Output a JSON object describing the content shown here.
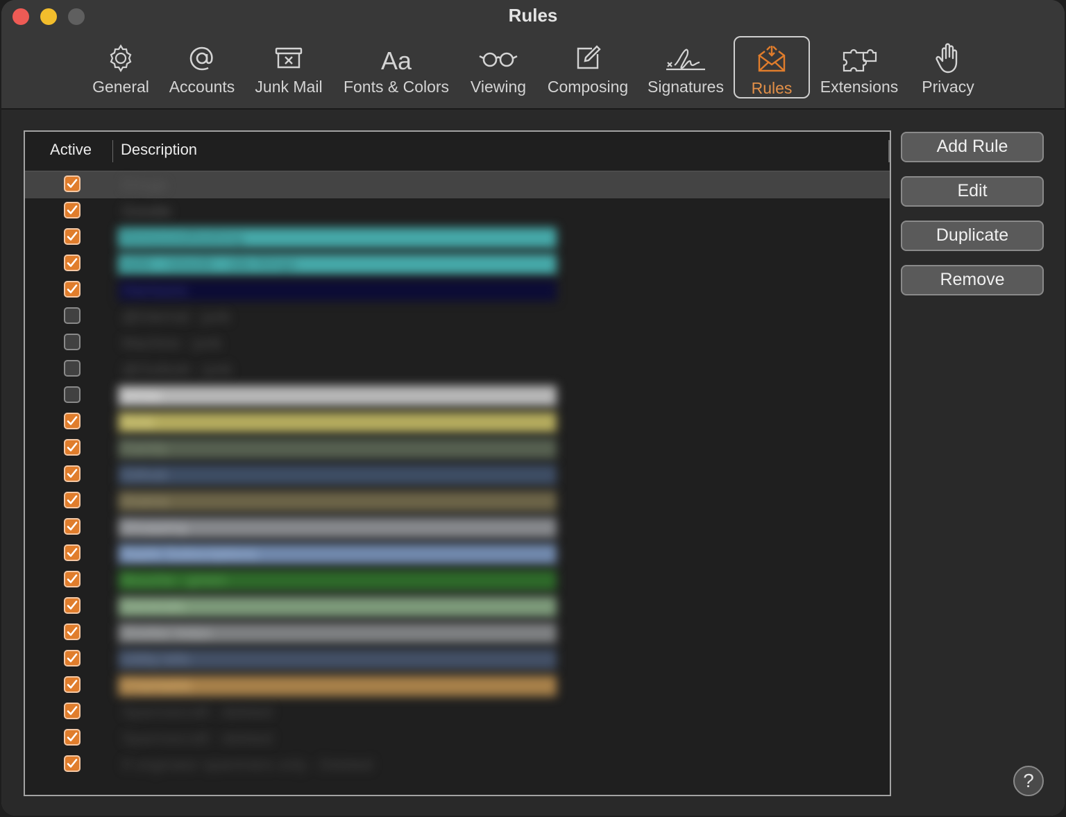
{
  "window": {
    "title": "Rules"
  },
  "toolbar": {
    "tabs": [
      {
        "id": "general",
        "label": "General",
        "icon": "gear-icon"
      },
      {
        "id": "accounts",
        "label": "Accounts",
        "icon": "at-sign-icon"
      },
      {
        "id": "junk",
        "label": "Junk Mail",
        "icon": "junk-bin-icon"
      },
      {
        "id": "fonts",
        "label": "Fonts & Colors",
        "icon": "font-icon"
      },
      {
        "id": "viewing",
        "label": "Viewing",
        "icon": "glasses-icon"
      },
      {
        "id": "composing",
        "label": "Composing",
        "icon": "compose-icon"
      },
      {
        "id": "signatures",
        "label": "Signatures",
        "icon": "signature-icon"
      },
      {
        "id": "rules",
        "label": "Rules",
        "icon": "rules-envelope-icon",
        "selected": true
      },
      {
        "id": "extensions",
        "label": "Extensions",
        "icon": "puzzle-icon"
      },
      {
        "id": "privacy",
        "label": "Privacy",
        "icon": "hand-icon"
      }
    ]
  },
  "table": {
    "headers": {
      "active": "Active",
      "description": "Description"
    },
    "rows": [
      {
        "active": true,
        "desc": "Ertuge",
        "color": "",
        "text": "#5a5a5a",
        "selected": true
      },
      {
        "active": true,
        "desc": "Goodie",
        "color": "",
        "text": "#5a5a5a"
      },
      {
        "active": true,
        "desc": "AnnoucedNothing",
        "color": "#46a9a9",
        "text": "#2a6b6b"
      },
      {
        "active": true,
        "desc": "addr - newsltr - site things",
        "color": "#46a9a9",
        "text": "#2a6b6b"
      },
      {
        "active": true,
        "desc": "Harrisons",
        "color": "#0c0c36",
        "text": "#3a3a7a"
      },
      {
        "active": false,
        "desc": "@Internal - junk",
        "color": "",
        "text": "#4e4e4e"
      },
      {
        "active": false,
        "desc": "Machine - junk",
        "color": "",
        "text": "#4e4e4e"
      },
      {
        "active": false,
        "desc": "@Outlook - junk",
        "color": "",
        "text": "#4e4e4e"
      },
      {
        "active": false,
        "desc": "White",
        "color": "#b8b8b8",
        "text": "#e8e8e8"
      },
      {
        "active": true,
        "desc": "Note",
        "color": "#b5ac5e",
        "text": "#e0d890"
      },
      {
        "active": true,
        "desc": "Family",
        "color": "#566050",
        "text": "#7a8670"
      },
      {
        "active": true,
        "desc": "Github",
        "color": "#3e4d64",
        "text": "#6d7d96"
      },
      {
        "active": true,
        "desc": "Drama",
        "color": "#6c6448",
        "text": "#958c6c"
      },
      {
        "active": true,
        "desc": "Shopping",
        "color": "#86888c",
        "text": "#b6b8bc"
      },
      {
        "active": true,
        "desc": "Apple Subscriptions",
        "color": "#7189ad",
        "text": "#a4bcde"
      },
      {
        "active": true,
        "desc": "Bouche - green",
        "color": "#2e6a2a",
        "text": "#5aa052"
      },
      {
        "active": true,
        "desc": "Generals",
        "color": "#7d9a7a",
        "text": "#a8c4a4"
      },
      {
        "active": true,
        "desc": "Shelter helps",
        "color": "#7e8082",
        "text": "#aeb0b2"
      },
      {
        "active": true,
        "desc": "Utility bills",
        "color": "#435066",
        "text": "#6d7c96"
      },
      {
        "active": true,
        "desc": "Charitable",
        "color": "#a8814a",
        "text": "#d6ae70"
      },
      {
        "active": true,
        "desc": "Sparrowcraft - deleted",
        "color": "",
        "text": "#454545"
      },
      {
        "active": true,
        "desc": "Sparrowcraft - deleted",
        "color": "",
        "text": "#454545"
      },
      {
        "active": true,
        "desc": "If originator spammers only - Deleted",
        "color": "",
        "text": "#454545"
      }
    ]
  },
  "buttons": {
    "add": "Add Rule",
    "edit": "Edit",
    "duplicate": "Duplicate",
    "remove": "Remove"
  },
  "help": {
    "label": "?"
  },
  "colors": {
    "accent": "#e07d2c",
    "selected_tab_text": "#e39048"
  }
}
